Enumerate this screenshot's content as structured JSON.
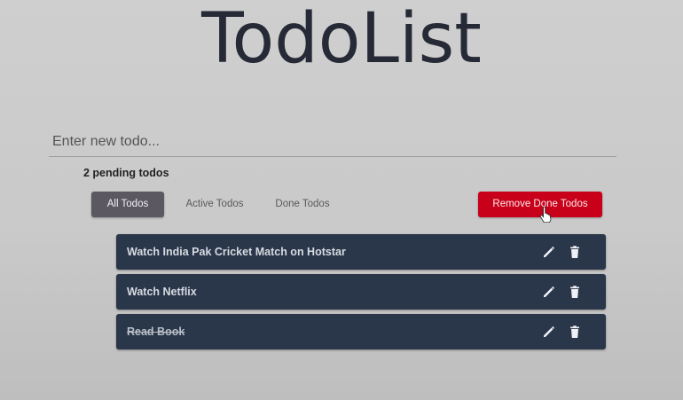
{
  "app": {
    "title": "TodoList"
  },
  "input": {
    "placeholder": "Enter new todo...",
    "value": ""
  },
  "status": {
    "pending_text": "2 pending todos"
  },
  "filters": [
    {
      "label": "All Todos",
      "active": true
    },
    {
      "label": "Active Todos",
      "active": false
    },
    {
      "label": "Done Todos",
      "active": false
    }
  ],
  "actions": {
    "remove_done_label": "Remove Done Todos"
  },
  "todos": [
    {
      "text": "Watch India Pak Cricket Match on Hotstar",
      "done": false
    },
    {
      "text": "Watch Netflix",
      "done": false
    },
    {
      "text": "Read Book",
      "done": true
    }
  ],
  "icons": {
    "edit": "pencil-icon",
    "delete": "trash-icon",
    "cursor": "hand-pointer-icon"
  },
  "colors": {
    "title": "#252a36",
    "active_filter_bg": "#5b5862",
    "danger": "#c8001a",
    "todo_bg": "#2a3649",
    "todo_text": "#d6dbe2"
  }
}
